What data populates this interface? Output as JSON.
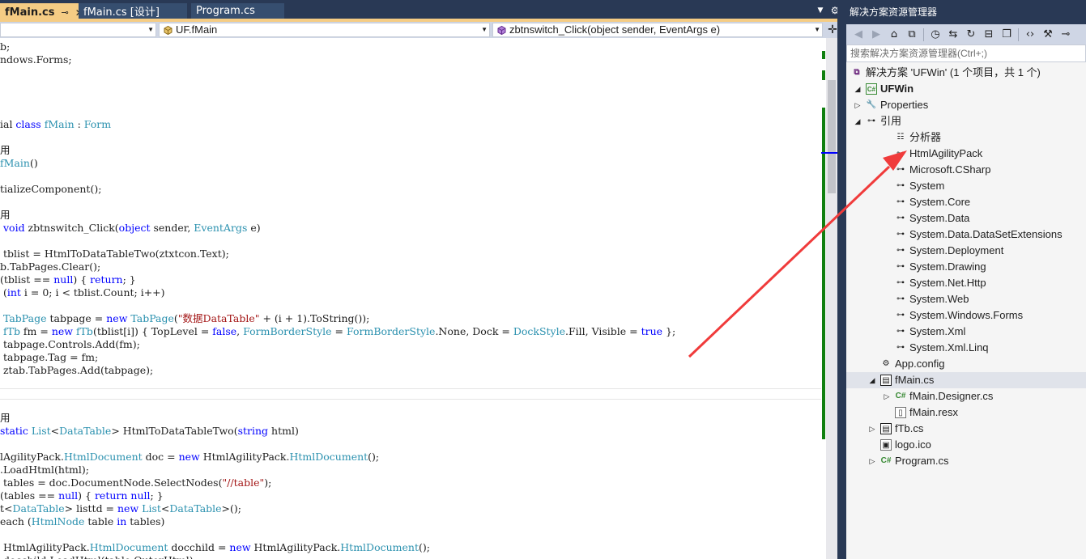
{
  "tabs": [
    {
      "label": "fMain.cs",
      "pin": "⊸",
      "close": "✕",
      "active": true
    },
    {
      "label": "fMain.cs [设计]",
      "active": false
    },
    {
      "label": "Program.cs",
      "active": false
    }
  ],
  "tab_strip": {
    "dropdown": "▼",
    "settings": "⚙"
  },
  "navbar": {
    "project_combo": "",
    "class_combo": "UF.fMain",
    "member_combo": "zbtnswitch_Click(object sender, EventArgs e)",
    "split_icon": "✛"
  },
  "code_lines": [
    "b;",
    "ndows.Forms;",
    "",
    "",
    "",
    "ial class fMain : Form",
    "",
    "用",
    "fMain()",
    "",
    "tializeComponent();",
    "",
    "用",
    " void zbtnswitch_Click(object sender, EventArgs e)",
    "",
    " tblist = HtmlToDataTableTwo(ztxtcon.Text);",
    "b.TabPages.Clear();",
    "(tblist == null) { return; }",
    " (int i = 0; i < tblist.Count; i++)",
    "",
    " TabPage tabpage = new TabPage(\"数据DataTable\" + (i + 1).ToString());",
    " fTb fm = new fTb(tblist[i]) { TopLevel = false, FormBorderStyle = FormBorderStyle.None, Dock = DockStyle.Fill, Visible = true };",
    " tabpage.Controls.Add(fm);",
    " tabpage.Tag = fm;",
    " ztab.TabPages.Add(tabpage);",
    "",
    "",
    "",
    "用",
    "static List<DataTable> HtmlToDataTableTwo(string html)",
    "",
    "lAgilityPack.HtmlDocument doc = new HtmlAgilityPack.HtmlDocument();",
    ".LoadHtml(html);",
    " tables = doc.DocumentNode.SelectNodes(\"//table\");",
    "(tables == null) { return null; }",
    "t<DataTable> listtd = new List<DataTable>();",
    "each (HtmlNode table in tables)",
    "",
    " HtmlAgilityPack.HtmlDocument docchild = new HtmlAgilityPack.HtmlDocument();",
    " docchild.LoadHtml(table.OuterHtml);"
  ],
  "solution_explorer": {
    "title": "解决方案资源管理器",
    "search_placeholder": "搜索解决方案资源管理器(Ctrl+;)",
    "toolbar_icons": [
      "back-icon",
      "forward-icon",
      "home-icon",
      "switch-views-icon",
      "pending-changes-icon",
      "history-icon",
      "sync-icon",
      "refresh-icon",
      "collapse-all-icon",
      "show-all-files-icon",
      "code-view-icon",
      "properties-icon",
      "preview-icon"
    ],
    "tree": [
      {
        "label": "解决方案 'UFWin' (1 个项目，共 1 个)",
        "icon": "solution-icon",
        "expander": ""
      },
      {
        "label": "UFWin",
        "icon": "csharp-project-icon",
        "expander": "▲",
        "bold": true
      },
      {
        "label": "Properties",
        "icon": "wrench-icon",
        "expander": "▶"
      },
      {
        "label": "引用",
        "icon": "references-icon",
        "expander": "▲"
      },
      {
        "label": "分析器",
        "icon": "analyzer-icon",
        "expander": ""
      },
      {
        "label": "HtmlAgilityPack",
        "icon": "reference-icon",
        "expander": ""
      },
      {
        "label": "Microsoft.CSharp",
        "icon": "reference-icon",
        "expander": ""
      },
      {
        "label": "System",
        "icon": "reference-icon",
        "expander": ""
      },
      {
        "label": "System.Core",
        "icon": "reference-icon",
        "expander": ""
      },
      {
        "label": "System.Data",
        "icon": "reference-icon",
        "expander": ""
      },
      {
        "label": "System.Data.DataSetExtensions",
        "icon": "reference-icon",
        "expander": ""
      },
      {
        "label": "System.Deployment",
        "icon": "reference-icon",
        "expander": ""
      },
      {
        "label": "System.Drawing",
        "icon": "reference-icon",
        "expander": ""
      },
      {
        "label": "System.Net.Http",
        "icon": "reference-icon",
        "expander": ""
      },
      {
        "label": "System.Web",
        "icon": "reference-icon",
        "expander": ""
      },
      {
        "label": "System.Windows.Forms",
        "icon": "reference-icon",
        "expander": ""
      },
      {
        "label": "System.Xml",
        "icon": "reference-icon",
        "expander": ""
      },
      {
        "label": "System.Xml.Linq",
        "icon": "reference-icon",
        "expander": ""
      },
      {
        "label": "App.config",
        "icon": "config-icon",
        "expander": ""
      },
      {
        "label": "fMain.cs",
        "icon": "form-icon",
        "expander": "▲",
        "selected": true
      },
      {
        "label": "fMain.Designer.cs",
        "icon": "csharp-file-icon",
        "expander": "▶"
      },
      {
        "label": "fMain.resx",
        "icon": "resx-icon",
        "expander": ""
      },
      {
        "label": "fTb.cs",
        "icon": "form-icon",
        "expander": "▶"
      },
      {
        "label": "logo.ico",
        "icon": "ico-file-icon",
        "expander": ""
      },
      {
        "label": "Program.cs",
        "icon": "csharp-file-icon",
        "expander": "▶"
      }
    ]
  },
  "colors": {
    "tab_strip_bg": "#293955",
    "active_tab_bg": "#f5cc84",
    "keyword": "#0000ff",
    "type": "#2b91af",
    "string": "#a31515",
    "change_bar": "#108010",
    "annotation_arrow": "#f03b3b"
  }
}
